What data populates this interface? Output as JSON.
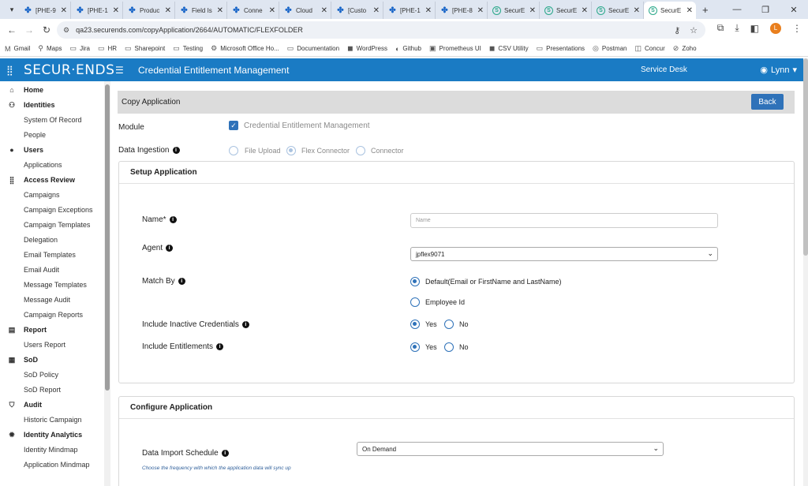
{
  "browser": {
    "tabs": [
      {
        "title": "[PHE-9",
        "favicon": "jira-icon",
        "active": false
      },
      {
        "title": "[PHE-1",
        "favicon": "jira-icon",
        "active": false
      },
      {
        "title": "Produc",
        "favicon": "jira-icon",
        "active": false
      },
      {
        "title": "Field Is",
        "favicon": "jira-icon",
        "active": false
      },
      {
        "title": "Conne",
        "favicon": "jira-icon",
        "active": false
      },
      {
        "title": "Cloud",
        "favicon": "jira-icon",
        "active": false
      },
      {
        "title": "[Custo",
        "favicon": "jira-icon",
        "active": false
      },
      {
        "title": "[PHE-1",
        "favicon": "jira-icon",
        "active": false
      },
      {
        "title": "[PHE-8",
        "favicon": "jira-icon",
        "active": false
      },
      {
        "title": "SecurE",
        "favicon": "securends-icon",
        "active": false
      },
      {
        "title": "SecurE",
        "favicon": "securends-icon",
        "active": false
      },
      {
        "title": "SecurE",
        "favicon": "securends-icon",
        "active": false
      },
      {
        "title": "SecurE",
        "favicon": "securends-icon",
        "active": true
      }
    ],
    "url": "qa23.securends.com/copyApplication/2664/AUTOMATIC/FLEXFOLDER",
    "profile_initial": "L",
    "bookmarks": [
      "Gmail",
      "Maps",
      "Jira",
      "HR",
      "Sharepoint",
      "Testing",
      "Microsoft Office Ho...",
      "Documentation",
      "WordPress",
      "Github",
      "Prometheus UI",
      "CSV Utility",
      "Presentations",
      "Postman",
      "Concur",
      "Zoho"
    ]
  },
  "header": {
    "logo": "SECUR·ENDS",
    "app_title": "Credential Entitlement Management",
    "service_desk": "Service Desk",
    "user": "Lynn",
    "color": "#1a7bc4"
  },
  "sidebar": {
    "items": [
      {
        "label": "Home",
        "type": "section",
        "icon": "home-icon"
      },
      {
        "label": "Identities",
        "type": "section",
        "icon": "people-icon"
      },
      {
        "label": "System Of Record",
        "type": "child"
      },
      {
        "label": "People",
        "type": "child"
      },
      {
        "label": "Users",
        "type": "section",
        "icon": "user-icon"
      },
      {
        "label": "Applications",
        "type": "child"
      },
      {
        "label": "Access Review",
        "type": "section",
        "icon": "grid-icon"
      },
      {
        "label": "Campaigns",
        "type": "child"
      },
      {
        "label": "Campaign Exceptions",
        "type": "child"
      },
      {
        "label": "Campaign Templates",
        "type": "child"
      },
      {
        "label": "Delegation",
        "type": "child"
      },
      {
        "label": "Email Templates",
        "type": "child"
      },
      {
        "label": "Email Audit",
        "type": "child"
      },
      {
        "label": "Message Templates",
        "type": "child"
      },
      {
        "label": "Message Audit",
        "type": "child"
      },
      {
        "label": "Campaign Reports",
        "type": "child"
      },
      {
        "label": "Report",
        "type": "section",
        "icon": "report-icon"
      },
      {
        "label": "Users Report",
        "type": "child"
      },
      {
        "label": "SoD",
        "type": "section",
        "icon": "sod-icon"
      },
      {
        "label": "SoD Policy",
        "type": "child"
      },
      {
        "label": "SoD Report",
        "type": "child"
      },
      {
        "label": "Audit",
        "type": "section",
        "icon": "shield-icon"
      },
      {
        "label": "Historic Campaign",
        "type": "child"
      },
      {
        "label": "Identity Analytics",
        "type": "section",
        "icon": "analytics-icon"
      },
      {
        "label": "Identity Mindmap",
        "type": "child"
      },
      {
        "label": "Application Mindmap",
        "type": "child"
      }
    ]
  },
  "page": {
    "title": "Copy Application",
    "back_label": "Back",
    "module_label": "Module",
    "module_value": "Credential Entitlement Management",
    "ingestion_label": "Data Ingestion",
    "ingestion_options": [
      "File Upload",
      "Flex Connector",
      "Connector"
    ],
    "ingestion_selected": "Flex Connector"
  },
  "setup": {
    "title": "Setup Application",
    "name_label": "Name*",
    "name_placeholder": "Name",
    "agent_label": "Agent",
    "agent_value": "jpflex9071",
    "match_label": "Match By",
    "match_options": [
      "Default(Email or FirstName and LastName)",
      "Employee Id"
    ],
    "inactive_label": "Include Inactive Credentials",
    "entitlements_label": "Include Entitlements",
    "yes": "Yes",
    "no": "No"
  },
  "configure": {
    "title": "Configure Application",
    "schedule_label": "Data Import Schedule",
    "schedule_value": "On Demand",
    "schedule_helper": "Choose the frequency with which the application data will sync up"
  }
}
